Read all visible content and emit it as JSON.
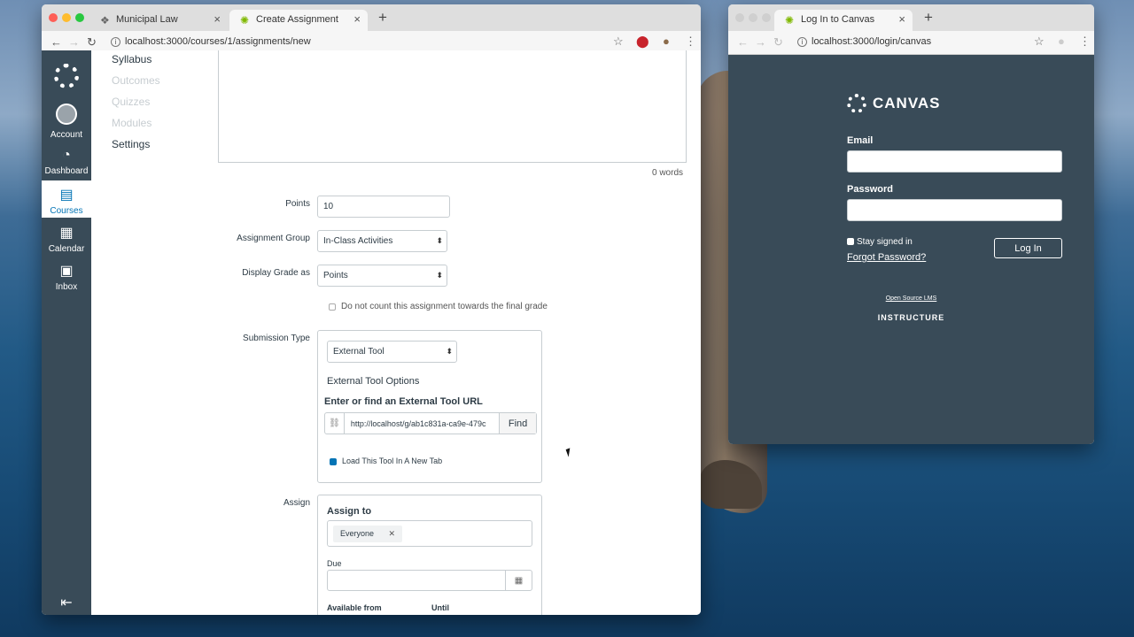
{
  "left_window": {
    "tabs": [
      {
        "label": "Municipal Law",
        "icon": "canvas-icon"
      },
      {
        "label": "Create Assignment",
        "icon": "canvas-loading-icon"
      }
    ],
    "url": "localhost:3000/courses/1/assignments/new",
    "global_nav": {
      "items": [
        {
          "label": "Account"
        },
        {
          "label": "Dashboard"
        },
        {
          "label": "Courses"
        },
        {
          "label": "Calendar"
        },
        {
          "label": "Inbox"
        }
      ]
    },
    "course_nav": [
      "Syllabus",
      "Outcomes",
      "Quizzes",
      "Modules",
      "Settings"
    ],
    "editor": {
      "word_count": "0 words"
    },
    "form": {
      "points_label": "Points",
      "points_value": "10",
      "group_label": "Assignment Group",
      "group_value": "In-Class Activities",
      "display_label": "Display Grade as",
      "display_value": "Points",
      "omit_label": "Do not count this assignment towards the final grade",
      "submission_label": "Submission Type",
      "submission_value": "External Tool",
      "ext_options": "External Tool Options",
      "ext_url_label": "Enter or find an External Tool URL",
      "ext_url_value": "http://localhost/g/ab1c831a-ca9e-479c",
      "find_button": "Find",
      "new_tab_label": "Load This Tool In A New Tab",
      "assign_label": "Assign",
      "assign_to": "Assign to",
      "assignee": "Everyone",
      "due_label": "Due",
      "available_from": "Available from",
      "until": "Until"
    }
  },
  "right_window": {
    "tab": "Log In to Canvas",
    "url": "localhost:3000/login/canvas",
    "brand": "CANVAS",
    "email_label": "Email",
    "password_label": "Password",
    "stay_signed_in": "Stay signed in",
    "forgot": "Forgot Password?",
    "login_button": "Log In",
    "open_source": "Open Source LMS",
    "instructure": "INSTRUCTURE"
  },
  "colors": {
    "nav_bg": "#394b58",
    "accent": "#0374b5"
  }
}
